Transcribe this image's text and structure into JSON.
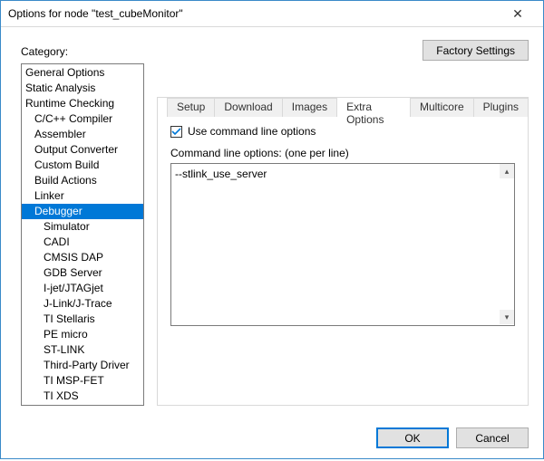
{
  "window": {
    "title": "Options for node \"test_cubeMonitor\"",
    "close": "✕"
  },
  "category": {
    "label": "Category:",
    "items": [
      {
        "label": "General Options",
        "indent": 0,
        "selected": false
      },
      {
        "label": "Static Analysis",
        "indent": 0,
        "selected": false
      },
      {
        "label": "Runtime Checking",
        "indent": 0,
        "selected": false
      },
      {
        "label": "C/C++ Compiler",
        "indent": 1,
        "selected": false
      },
      {
        "label": "Assembler",
        "indent": 1,
        "selected": false
      },
      {
        "label": "Output Converter",
        "indent": 1,
        "selected": false
      },
      {
        "label": "Custom Build",
        "indent": 1,
        "selected": false
      },
      {
        "label": "Build Actions",
        "indent": 1,
        "selected": false
      },
      {
        "label": "Linker",
        "indent": 1,
        "selected": false
      },
      {
        "label": "Debugger",
        "indent": 1,
        "selected": true
      },
      {
        "label": "Simulator",
        "indent": 2,
        "selected": false
      },
      {
        "label": "CADI",
        "indent": 2,
        "selected": false
      },
      {
        "label": "CMSIS DAP",
        "indent": 2,
        "selected": false
      },
      {
        "label": "GDB Server",
        "indent": 2,
        "selected": false
      },
      {
        "label": "I-jet/JTAGjet",
        "indent": 2,
        "selected": false
      },
      {
        "label": "J-Link/J-Trace",
        "indent": 2,
        "selected": false
      },
      {
        "label": "TI Stellaris",
        "indent": 2,
        "selected": false
      },
      {
        "label": "PE micro",
        "indent": 2,
        "selected": false
      },
      {
        "label": "ST-LINK",
        "indent": 2,
        "selected": false
      },
      {
        "label": "Third-Party Driver",
        "indent": 2,
        "selected": false
      },
      {
        "label": "TI MSP-FET",
        "indent": 2,
        "selected": false
      },
      {
        "label": "TI XDS",
        "indent": 2,
        "selected": false
      }
    ]
  },
  "buttons": {
    "factory": "Factory Settings",
    "ok": "OK",
    "cancel": "Cancel"
  },
  "tabs": [
    {
      "label": "Setup",
      "active": false
    },
    {
      "label": "Download",
      "active": false
    },
    {
      "label": "Images",
      "active": false
    },
    {
      "label": "Extra Options",
      "active": true
    },
    {
      "label": "Multicore",
      "active": false
    },
    {
      "label": "Plugins",
      "active": false
    }
  ],
  "extra": {
    "use_cmd_label": "Use command line options",
    "use_cmd_checked": true,
    "cmd_label": "Command line options:  (one per line)",
    "cmd_value": "--stlink_use_server"
  },
  "scroll": {
    "up": "▴",
    "down": "▾"
  }
}
